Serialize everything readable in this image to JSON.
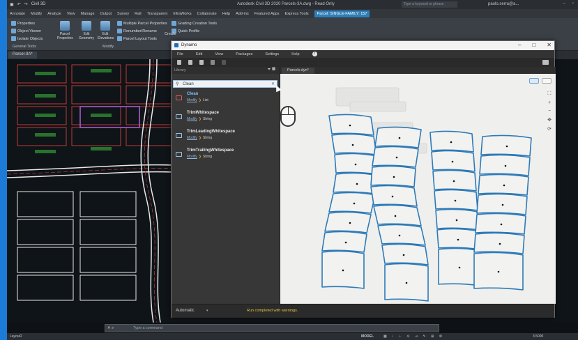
{
  "acad": {
    "qat_product": "Civil 3D",
    "title": "Autodesk Civil 3D 2020   Parcels-3A.dwg - Read Only",
    "search_placeholder": "Type a keyword or phrase",
    "user": "paolo.serra@a...",
    "tabs": [
      "Annotate",
      "Modify",
      "Analyze",
      "View",
      "Manage",
      "Output",
      "Survey",
      "Rail",
      "Transparent",
      "InfraWorks",
      "Collaborate",
      "Help",
      "Add-ins",
      "Featured Apps",
      "Express Tools",
      "Parcel: SINGLE-FAMILY: 157"
    ],
    "ribbon": {
      "properties": "Properties",
      "object_viewer": "Object Viewer",
      "isolate_objects": "Isolate Objects",
      "general_tools": "General Tools",
      "parcel_properties": "Parcel Properties",
      "edit_geometry": "Edit Geometry",
      "edit_elevations": "Edit Elevations",
      "multiple_parcel_properties": "Multiple Parcel Properties",
      "renumber_rename": "Renumber/Rename",
      "parcel_layout_tools": "Parcel Layout Tools",
      "modify": "Modify",
      "grading_creation_tools": "Grading Creation Tools",
      "quick_profile": "Quick Profile",
      "create": "Create"
    },
    "doc_tab": "Parcel-3A*",
    "command_prompt": "Type a command",
    "layout_tab": "Layout2",
    "status_model": "MODEL",
    "status_scale": "1:1",
    "status_zoom": "3.5000"
  },
  "dynamo": {
    "title": "Dynamo",
    "menu": [
      "File",
      "Edit",
      "View",
      "Packages",
      "Settings",
      "Help"
    ],
    "library_label": "Library",
    "search_value": "Clean",
    "results": [
      {
        "name": "Clean",
        "category": "Modify",
        "type": "List"
      },
      {
        "name": "TrimWhitespace",
        "category": "Modify",
        "type": "String"
      },
      {
        "name": "TrimLeadingWhitespace",
        "category": "Modify",
        "type": "String"
      },
      {
        "name": "TrimTrailingWhitespace",
        "category": "Modify",
        "type": "String"
      }
    ],
    "graph_tab": "Parcels.dyn*",
    "run_mode": "Automatic",
    "status_message": "Run completed with warnings."
  },
  "colors": {
    "accent_blue": "#1b7bd6",
    "parcel_stroke": "#2d7ab8",
    "warning_text": "#e6c23a"
  }
}
